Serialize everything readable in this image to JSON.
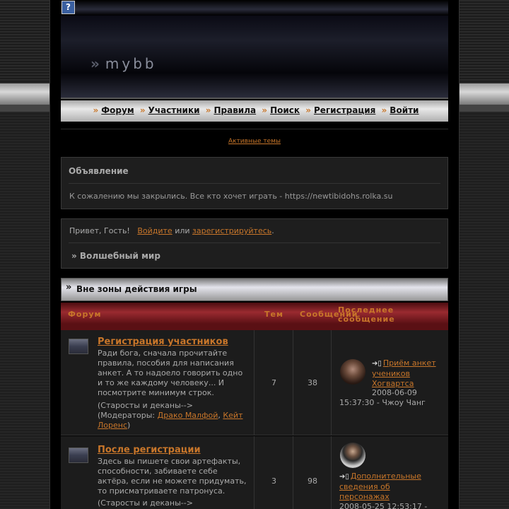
{
  "header": {
    "help_icon": "?",
    "logo_text": "mybb",
    "logo_arrows": "»"
  },
  "nav": {
    "separator": "»",
    "items": [
      {
        "label": "Форум"
      },
      {
        "label": "Участники"
      },
      {
        "label": "Правила"
      },
      {
        "label": "Поиск"
      },
      {
        "label": "Регистрация"
      },
      {
        "label": "Войти"
      }
    ]
  },
  "active_topics": "Активные темы",
  "announcement": {
    "title": "Объявление",
    "text": "К сожалению мы закрылись. Все кто хочет играть - https://newtibidohs.rolka.su"
  },
  "greeting": {
    "prefix": "Привет, Гость!",
    "login": "Войдите",
    "or": "или",
    "register": "зарегистрируйтесь",
    "dot": ".",
    "crumb": "» Волшебный мир"
  },
  "category": {
    "arrow": "»",
    "title": "Вне зоны действия игры"
  },
  "columns": {
    "forum": "Форум",
    "topics": "Тем",
    "posts": "Сообщений",
    "last_post": "Последнее сообщение"
  },
  "forums": [
    {
      "name": "Регистрация участников",
      "desc": "Ради бога, сначала прочитайте правила, пособия для написания анкет. А то надоело говорить одно и то же каждому человеку... И посмотрите минимум строк.",
      "mods_prefix": "(Старосты и деканы--> (Модераторы:",
      "mod1": "Драко Малфой",
      "comma": ",",
      "mod2": "Кейт Лоренс",
      "close": ")",
      "topics": "7",
      "posts": "38",
      "last_title": "Приём анкет учеников Хогвартса",
      "last_meta": "2008-06-09 15:37:30 - Чжоу Чанг"
    },
    {
      "name": "После регистрации",
      "desc": "Здесь вы пишете свои артефакты, способности, забиваете себе актёра, если не можете придумать, то присматриваете патронуса.",
      "mods_prefix": "(Старосты и деканы-->",
      "topics": "3",
      "posts": "98",
      "last_title": "Дополнительные сведения об персонажах",
      "last_meta": "2008-05-25 12:53:17 -"
    }
  ],
  "colors": {
    "accent": "#c8762a",
    "header_red": "#9a2a30"
  },
  "icons": [
    "help-icon",
    "forum-icon",
    "last-post-icon",
    "avatar"
  ]
}
